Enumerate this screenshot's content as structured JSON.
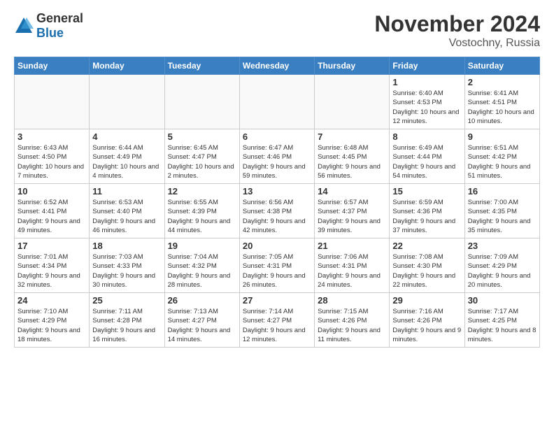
{
  "header": {
    "logo_general": "General",
    "logo_blue": "Blue",
    "month_title": "November 2024",
    "location": "Vostochny, Russia"
  },
  "days_of_week": [
    "Sunday",
    "Monday",
    "Tuesday",
    "Wednesday",
    "Thursday",
    "Friday",
    "Saturday"
  ],
  "weeks": [
    [
      {
        "day": "",
        "info": ""
      },
      {
        "day": "",
        "info": ""
      },
      {
        "day": "",
        "info": ""
      },
      {
        "day": "",
        "info": ""
      },
      {
        "day": "",
        "info": ""
      },
      {
        "day": "1",
        "info": "Sunrise: 6:40 AM\nSunset: 4:53 PM\nDaylight: 10 hours and 12 minutes."
      },
      {
        "day": "2",
        "info": "Sunrise: 6:41 AM\nSunset: 4:51 PM\nDaylight: 10 hours and 10 minutes."
      }
    ],
    [
      {
        "day": "3",
        "info": "Sunrise: 6:43 AM\nSunset: 4:50 PM\nDaylight: 10 hours and 7 minutes."
      },
      {
        "day": "4",
        "info": "Sunrise: 6:44 AM\nSunset: 4:49 PM\nDaylight: 10 hours and 4 minutes."
      },
      {
        "day": "5",
        "info": "Sunrise: 6:45 AM\nSunset: 4:47 PM\nDaylight: 10 hours and 2 minutes."
      },
      {
        "day": "6",
        "info": "Sunrise: 6:47 AM\nSunset: 4:46 PM\nDaylight: 9 hours and 59 minutes."
      },
      {
        "day": "7",
        "info": "Sunrise: 6:48 AM\nSunset: 4:45 PM\nDaylight: 9 hours and 56 minutes."
      },
      {
        "day": "8",
        "info": "Sunrise: 6:49 AM\nSunset: 4:44 PM\nDaylight: 9 hours and 54 minutes."
      },
      {
        "day": "9",
        "info": "Sunrise: 6:51 AM\nSunset: 4:42 PM\nDaylight: 9 hours and 51 minutes."
      }
    ],
    [
      {
        "day": "10",
        "info": "Sunrise: 6:52 AM\nSunset: 4:41 PM\nDaylight: 9 hours and 49 minutes."
      },
      {
        "day": "11",
        "info": "Sunrise: 6:53 AM\nSunset: 4:40 PM\nDaylight: 9 hours and 46 minutes."
      },
      {
        "day": "12",
        "info": "Sunrise: 6:55 AM\nSunset: 4:39 PM\nDaylight: 9 hours and 44 minutes."
      },
      {
        "day": "13",
        "info": "Sunrise: 6:56 AM\nSunset: 4:38 PM\nDaylight: 9 hours and 42 minutes."
      },
      {
        "day": "14",
        "info": "Sunrise: 6:57 AM\nSunset: 4:37 PM\nDaylight: 9 hours and 39 minutes."
      },
      {
        "day": "15",
        "info": "Sunrise: 6:59 AM\nSunset: 4:36 PM\nDaylight: 9 hours and 37 minutes."
      },
      {
        "day": "16",
        "info": "Sunrise: 7:00 AM\nSunset: 4:35 PM\nDaylight: 9 hours and 35 minutes."
      }
    ],
    [
      {
        "day": "17",
        "info": "Sunrise: 7:01 AM\nSunset: 4:34 PM\nDaylight: 9 hours and 32 minutes."
      },
      {
        "day": "18",
        "info": "Sunrise: 7:03 AM\nSunset: 4:33 PM\nDaylight: 9 hours and 30 minutes."
      },
      {
        "day": "19",
        "info": "Sunrise: 7:04 AM\nSunset: 4:32 PM\nDaylight: 9 hours and 28 minutes."
      },
      {
        "day": "20",
        "info": "Sunrise: 7:05 AM\nSunset: 4:31 PM\nDaylight: 9 hours and 26 minutes."
      },
      {
        "day": "21",
        "info": "Sunrise: 7:06 AM\nSunset: 4:31 PM\nDaylight: 9 hours and 24 minutes."
      },
      {
        "day": "22",
        "info": "Sunrise: 7:08 AM\nSunset: 4:30 PM\nDaylight: 9 hours and 22 minutes."
      },
      {
        "day": "23",
        "info": "Sunrise: 7:09 AM\nSunset: 4:29 PM\nDaylight: 9 hours and 20 minutes."
      }
    ],
    [
      {
        "day": "24",
        "info": "Sunrise: 7:10 AM\nSunset: 4:29 PM\nDaylight: 9 hours and 18 minutes."
      },
      {
        "day": "25",
        "info": "Sunrise: 7:11 AM\nSunset: 4:28 PM\nDaylight: 9 hours and 16 minutes."
      },
      {
        "day": "26",
        "info": "Sunrise: 7:13 AM\nSunset: 4:27 PM\nDaylight: 9 hours and 14 minutes."
      },
      {
        "day": "27",
        "info": "Sunrise: 7:14 AM\nSunset: 4:27 PM\nDaylight: 9 hours and 12 minutes."
      },
      {
        "day": "28",
        "info": "Sunrise: 7:15 AM\nSunset: 4:26 PM\nDaylight: 9 hours and 11 minutes."
      },
      {
        "day": "29",
        "info": "Sunrise: 7:16 AM\nSunset: 4:26 PM\nDaylight: 9 hours and 9 minutes."
      },
      {
        "day": "30",
        "info": "Sunrise: 7:17 AM\nSunset: 4:25 PM\nDaylight: 9 hours and 8 minutes."
      }
    ]
  ]
}
